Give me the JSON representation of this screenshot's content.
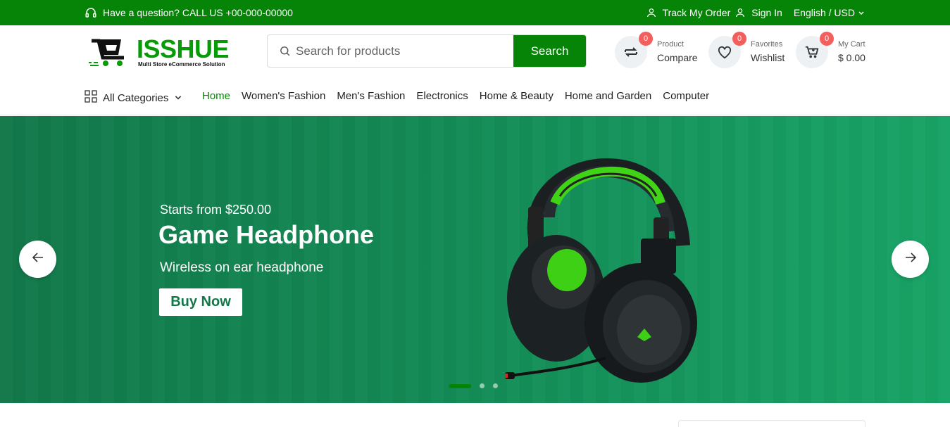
{
  "topbar": {
    "question": "Have a question? CALL US +00-000-00000",
    "track_order": "Track My Order",
    "sign_in": "Sign In",
    "language": "English / USD"
  },
  "header": {
    "logo_brand": "ISSHUE",
    "logo_tagline": "Multi Store eCommerce Solution",
    "search": {
      "placeholder": "Search for products",
      "button": "Search"
    },
    "compare": {
      "badge": "0",
      "small": "Product",
      "big": "Compare"
    },
    "wishlist": {
      "badge": "0",
      "small": "Favorites",
      "big": "Wishlist"
    },
    "cart": {
      "badge": "0",
      "small": "My Cart",
      "big": "$ 0.00"
    }
  },
  "nav": {
    "all_categories": "All Categories",
    "items": [
      "Home",
      "Women's Fashion",
      "Men's Fashion",
      "Electronics",
      "Home & Beauty",
      "Home and Garden",
      "Computer"
    ],
    "active_index": 0
  },
  "hero": {
    "kicker": "Starts from $250.00",
    "title": "Game Headphone",
    "subtitle": "Wireless on ear headphone",
    "button": "Buy Now",
    "slides": 3,
    "active_slide": 0
  },
  "colors": {
    "brand_green": "#068407",
    "hero_bg": "#12784a",
    "badge_red": "#f25f5c"
  }
}
